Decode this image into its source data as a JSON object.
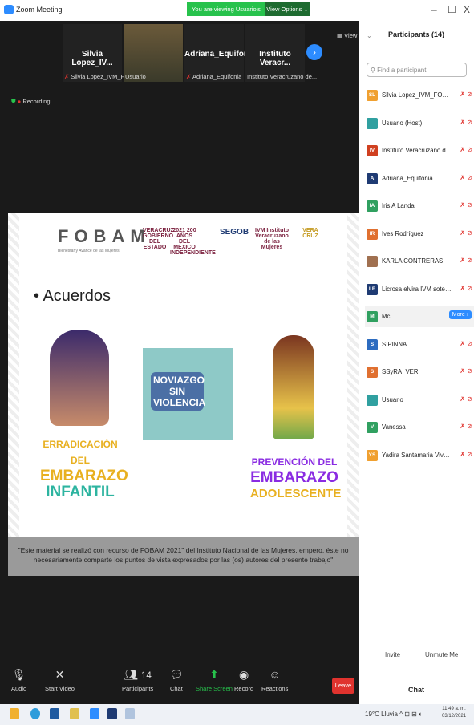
{
  "window": {
    "title": "Zoom Meeting",
    "share_banner": "You are viewing Usuario's screen",
    "view_options": "View Options ⌄",
    "minimize": "–",
    "maximize": "☐",
    "close": "X"
  },
  "gallery": {
    "tiles": [
      {
        "name": "Silvia Lopez_IV...",
        "sub": "Silvia Lopez_IVM_FOB..."
      },
      {
        "name": "",
        "sub": "Usuario"
      },
      {
        "name": "Adriana_Equifonia",
        "sub": "Adriana_Equifonia"
      },
      {
        "name": "Instituto Veracr...",
        "sub": "Instituto Veracruzano de..."
      }
    ],
    "view_label": "▦ View",
    "recording_label": "Recording"
  },
  "slide": {
    "fobam": "FOBAM",
    "fobam_sub": "Bienestar y Avance de las Mujeres",
    "logos": [
      "VERACRUZ GOBIERNO DEL ESTADO",
      "2021 200 AÑOS DEL MÉXICO INDEPENDIENTE",
      "SEGOB",
      "IVM Instituto Veracruzano de las Mujeres",
      "VERA CRUZ"
    ],
    "heading": "• Acuerdos",
    "left_title": [
      "ERRADICACIÓN DEL",
      "EMBARAZO",
      "INFANTIL"
    ],
    "mid_title": [
      "NOVIAZGO",
      "SIN",
      "VIOLENCIA"
    ],
    "right_title": [
      "PREVENCIÓN DEL",
      "EMBARAZO",
      "ADOLESCENTE"
    ],
    "disclaimer": "\"Este material se realizó con recurso de FOBAM 2021\" del Instituto Nacional de las Mujeres, empero, éste no necesariamente comparte los puntos de vista expresados por las (os) autores del presente trabajo\""
  },
  "toolbar": {
    "audio": "Audio",
    "start_video": "Start Video",
    "participants": "Participants",
    "participants_count": "14",
    "chat": "Chat",
    "share_screen": "Share Screen",
    "record": "Record",
    "reactions": "Reactions",
    "leave": "Leave"
  },
  "panel": {
    "title": "Participants (14)",
    "search_placeholder": "Find a participant",
    "participants": [
      {
        "initials": "SL",
        "color": "#f0a030",
        "name": "Silvia Lopez_IVM_FOBAMMonito... (Me)"
      },
      {
        "initials": "",
        "color": "#30a0a0",
        "name": "Usuario (Host)"
      },
      {
        "initials": "IV",
        "color": "#d04020",
        "name": "Instituto Veracruzano de las Muje..."
      },
      {
        "initials": "A",
        "color": "#1f3b73",
        "name": "Adriana_Equifonia"
      },
      {
        "initials": "IA",
        "color": "#30a060",
        "name": "Iris A Landa"
      },
      {
        "initials": "IR",
        "color": "#e07030",
        "name": "Ives Rodríguez"
      },
      {
        "initials": "",
        "color": "#a07050",
        "name": "KARLA CONTRERAS"
      },
      {
        "initials": "LE",
        "color": "#1f3b73",
        "name": "Licrosa elvira IVM soteapan"
      },
      {
        "initials": "M",
        "color": "#30a060",
        "name": "Mc"
      },
      {
        "initials": "S",
        "color": "#2d6cc0",
        "name": "SIPINNA"
      },
      {
        "initials": "S",
        "color": "#e07030",
        "name": "SSyRA_VER"
      },
      {
        "initials": "",
        "color": "#30a0a0",
        "name": "Usuario"
      },
      {
        "initials": "V",
        "color": "#30a060",
        "name": "Vanessa"
      },
      {
        "initials": "YS",
        "color": "#f0a030",
        "name": "Yadira Santamaria Viveros"
      }
    ],
    "more_button": "More ›",
    "invite": "Invite",
    "unmute_me": "Unmute Me",
    "chat_title": "Chat"
  },
  "taskbar": {
    "weather": "19°C Lluvia",
    "time": "11:49 a. m.",
    "date": "03/12/2021"
  }
}
